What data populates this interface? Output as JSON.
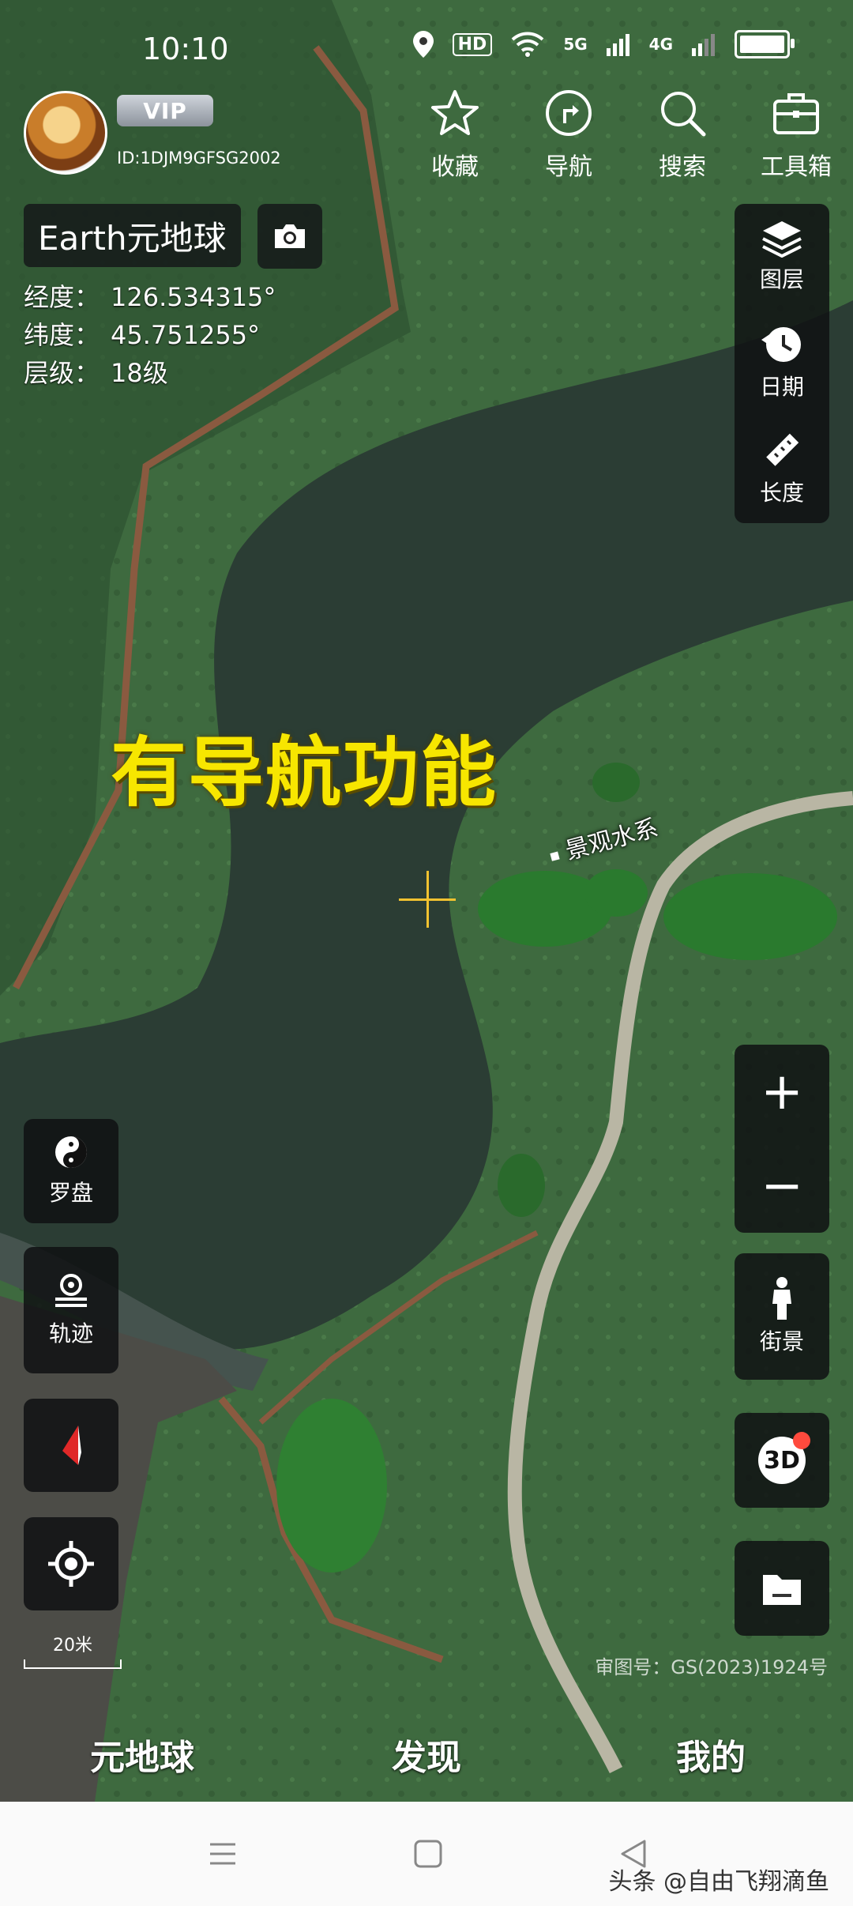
{
  "status_bar": {
    "time": "10:10",
    "hd_label": "HD",
    "net_5g": "5G",
    "net_4g": "4G"
  },
  "header": {
    "vip_label": "VIP",
    "user_id": "ID:1DJM9GFSG2002",
    "buttons": [
      {
        "label": "收藏",
        "icon": "star-icon"
      },
      {
        "label": "导航",
        "icon": "navigation-icon"
      },
      {
        "label": "搜索",
        "icon": "search-icon"
      },
      {
        "label": "工具箱",
        "icon": "toolbox-icon"
      }
    ]
  },
  "title": "Earth元地球",
  "coords": {
    "lng_label": "经度：",
    "lng_value": "126.534315°",
    "lat_label": "纬度：",
    "lat_value": "45.751255°",
    "level_label": "层级：",
    "level_value": "18级"
  },
  "right_panel": [
    {
      "label": "图层",
      "icon": "layers-icon"
    },
    {
      "label": "日期",
      "icon": "date-clock-icon"
    },
    {
      "label": "长度",
      "icon": "ruler-icon"
    }
  ],
  "zoom": {
    "in": "+",
    "out": "−"
  },
  "street_view": {
    "label": "街景",
    "icon": "pedestrian-icon"
  },
  "mode_3d": {
    "label": "3D"
  },
  "left_panel": {
    "compass": {
      "label": "罗盘",
      "icon": "yin-yang-icon"
    },
    "track": {
      "label": "轨迹",
      "icon": "location-pin-icon"
    }
  },
  "scale": "20米",
  "approval": "审图号：GS(2023)1924号",
  "overlay_text": "有导航功能",
  "place_label": "景观水系",
  "tabs": [
    "元地球",
    "发现",
    "我的"
  ],
  "watermark": "头条 @自由飞翔滴鱼",
  "colors": {
    "overlay_yellow": "#f7e600",
    "crosshair": "#f2c230",
    "badge_red": "#ff4a3d"
  }
}
